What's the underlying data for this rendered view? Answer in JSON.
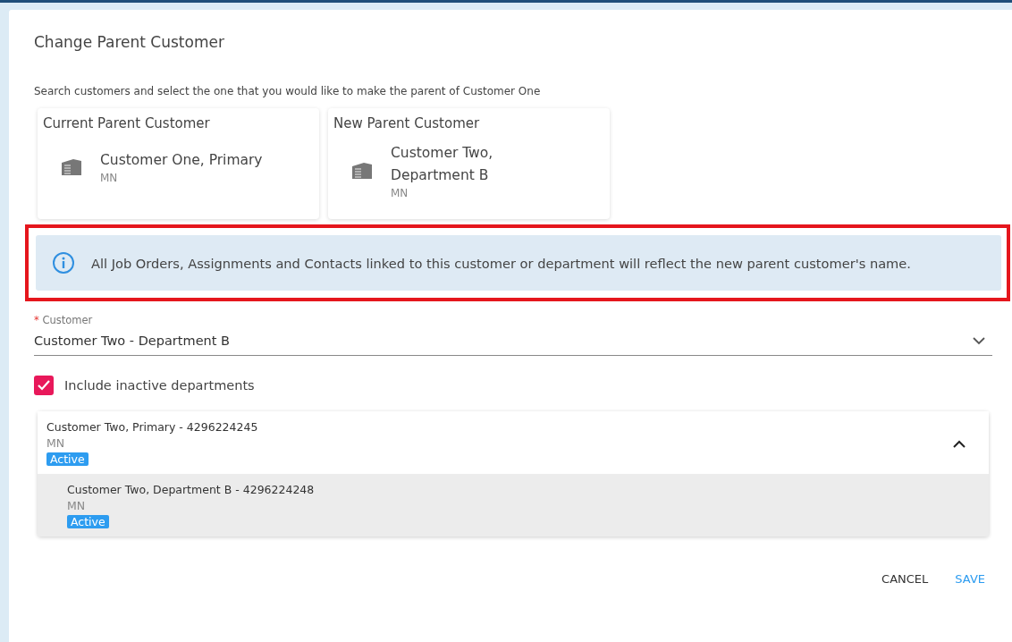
{
  "dialog": {
    "title": "Change Parent Customer",
    "instructions": "Search customers and select the one that you would like to make the parent of Customer One"
  },
  "parent_cards": [
    {
      "heading": "Current Parent Customer",
      "name": "Customer One, Primary",
      "state": "MN"
    },
    {
      "heading": "New Parent Customer",
      "name": "Customer Two, Department B",
      "state": "MN"
    }
  ],
  "notice": {
    "text": "All Job Orders, Assignments and Contacts linked to this customer or department will reflect the new parent customer's name.",
    "highlighted": true
  },
  "customer_field": {
    "label": "Customer",
    "required_mark": "*",
    "value": "Customer Two - Department B"
  },
  "include_inactive": {
    "label": "Include inactive departments",
    "checked": true
  },
  "results": [
    {
      "name": "Customer Two, Primary - 4296224245",
      "state": "MN",
      "status": "Active",
      "expanded": true,
      "selected": false,
      "children": [
        {
          "name": "Customer Two, Department B - 4296224248",
          "state": "MN",
          "status": "Active",
          "selected": true
        }
      ]
    }
  ],
  "buttons": [
    {
      "label": "CANCEL",
      "kind": "secondary"
    },
    {
      "label": "SAVE",
      "kind": "primary"
    }
  ]
}
